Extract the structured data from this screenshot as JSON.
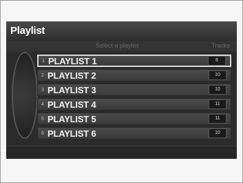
{
  "screen": {
    "title": "Playlist",
    "hint": "Select a playlist",
    "tracks_header": "Tracks"
  },
  "playlists": [
    {
      "index": "1",
      "name": "PLAYLIST 1",
      "count": "8"
    },
    {
      "index": "2",
      "name": "PLAYLIST 2",
      "count": "10"
    },
    {
      "index": "3",
      "name": "PLAYLIST 3",
      "count": "10"
    },
    {
      "index": "4",
      "name": "PLAYLIST 4",
      "count": "11"
    },
    {
      "index": "5",
      "name": "PLAYLIST 5",
      "count": "11"
    },
    {
      "index": "6",
      "name": "PLAYLIST 6",
      "count": "10"
    }
  ],
  "selected_index": 0
}
